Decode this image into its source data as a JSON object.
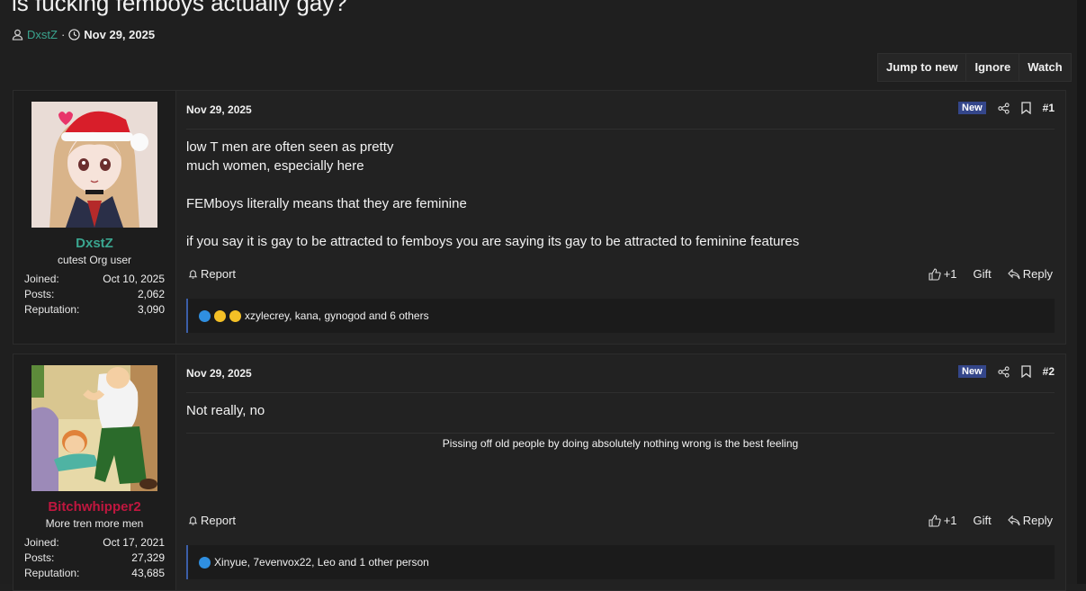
{
  "thread": {
    "title": "is fucking femboys actually gay?",
    "author": "DxstZ",
    "separator": "·",
    "date": "Nov 29, 2025"
  },
  "actions": {
    "jump": "Jump to new",
    "ignore": "Ignore",
    "watch": "Watch"
  },
  "labels": {
    "joined": "Joined:",
    "posts": "Posts:",
    "reputation": "Reputation:",
    "new_badge": "New",
    "report": "Report",
    "like": "+1",
    "gift": "Gift",
    "reply": "Reply"
  },
  "colors": {
    "author_color_1": "#3aa58f",
    "author_color_2": "#c0173f",
    "new_badge": "#34468a",
    "react_border": "#3b5ea8"
  },
  "posts": [
    {
      "user": {
        "name": "DxstZ",
        "title": "cutest Org user",
        "joined": "Oct 10, 2025",
        "posts": "2,062",
        "reputation": "3,090"
      },
      "date": "Nov 29, 2025",
      "number": "#1",
      "body": [
        "low T men are often seen as pretty",
        "much women, especially here",
        "",
        "FEMboys literally means that they are feminine",
        "",
        "if you say it is gay to be attracted to femboys you are saying its gay to be attracted to feminine features"
      ],
      "reactions_icons": [
        "like-icon",
        "laugh-icon",
        "wow-icon"
      ],
      "reactions_text": "xzylecrey, kana, gynogod and 6 others"
    },
    {
      "user": {
        "name": "Bitchwhipper2",
        "title": "More tren more men",
        "joined": "Oct 17, 2021",
        "posts": "27,329",
        "reputation": "43,685"
      },
      "date": "Nov 29, 2025",
      "number": "#2",
      "body": [
        "Not really, no"
      ],
      "signature": "Pissing off old people by doing absolutely nothing wrong is the best feeling",
      "reactions_icons": [
        "like-icon"
      ],
      "reactions_text": "Xinyue, 7evenvox22, Leo and 1 other person"
    }
  ]
}
